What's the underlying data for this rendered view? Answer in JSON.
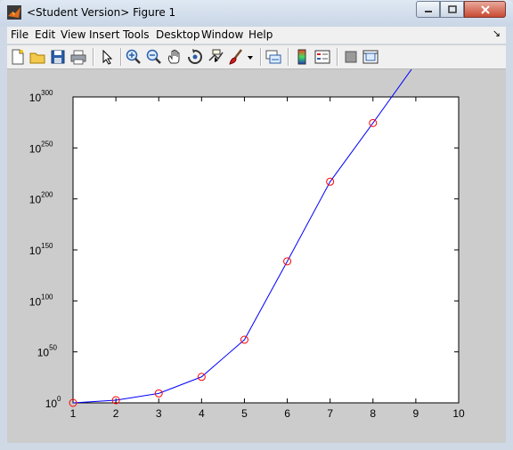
{
  "window": {
    "title": "<Student Version> Figure 1",
    "controls": {
      "minimize": "minimize",
      "maximize": "maximize",
      "close": "close"
    }
  },
  "menubar": {
    "items": [
      {
        "label": "File"
      },
      {
        "label": "Edit"
      },
      {
        "label": "View"
      },
      {
        "label": "Insert"
      },
      {
        "label": "Tools"
      },
      {
        "label": "Desktop"
      },
      {
        "label": "Window"
      },
      {
        "label": "Help"
      }
    ]
  },
  "toolbar": {
    "icons": [
      "new-figure-icon",
      "open-file-icon",
      "save-icon",
      "print-icon",
      "edit-plot-arrow-icon",
      "zoom-in-icon",
      "zoom-out-icon",
      "pan-hand-icon",
      "rotate-3d-icon",
      "data-cursor-icon",
      "brush-icon",
      "brush-dropdown-icon",
      "link-plot-icon",
      "colorbar-icon",
      "legend-icon",
      "hide-plot-tools-icon",
      "show-plot-tools-icon"
    ]
  },
  "chart_data": {
    "type": "line",
    "yscale": "log",
    "x": [
      1,
      2,
      3,
      4,
      5,
      6,
      7,
      8,
      9
    ],
    "y_log10": [
      0,
      2.6,
      9.3,
      25.5,
      61.9,
      138.8,
      216.9,
      274.4,
      333.0
    ],
    "line_color": "#0000ff",
    "marker": "circle",
    "marker_color": "#ff0000",
    "xlim": [
      1,
      10
    ],
    "ylim_log10": [
      0,
      300
    ],
    "xticks": [
      "1",
      "2",
      "3",
      "4",
      "5",
      "6",
      "7",
      "8",
      "9",
      "10"
    ],
    "ytick_base": "10",
    "yticks_exp": [
      "0",
      "50",
      "100",
      "150",
      "200",
      "250",
      "300"
    ],
    "grid": false
  }
}
